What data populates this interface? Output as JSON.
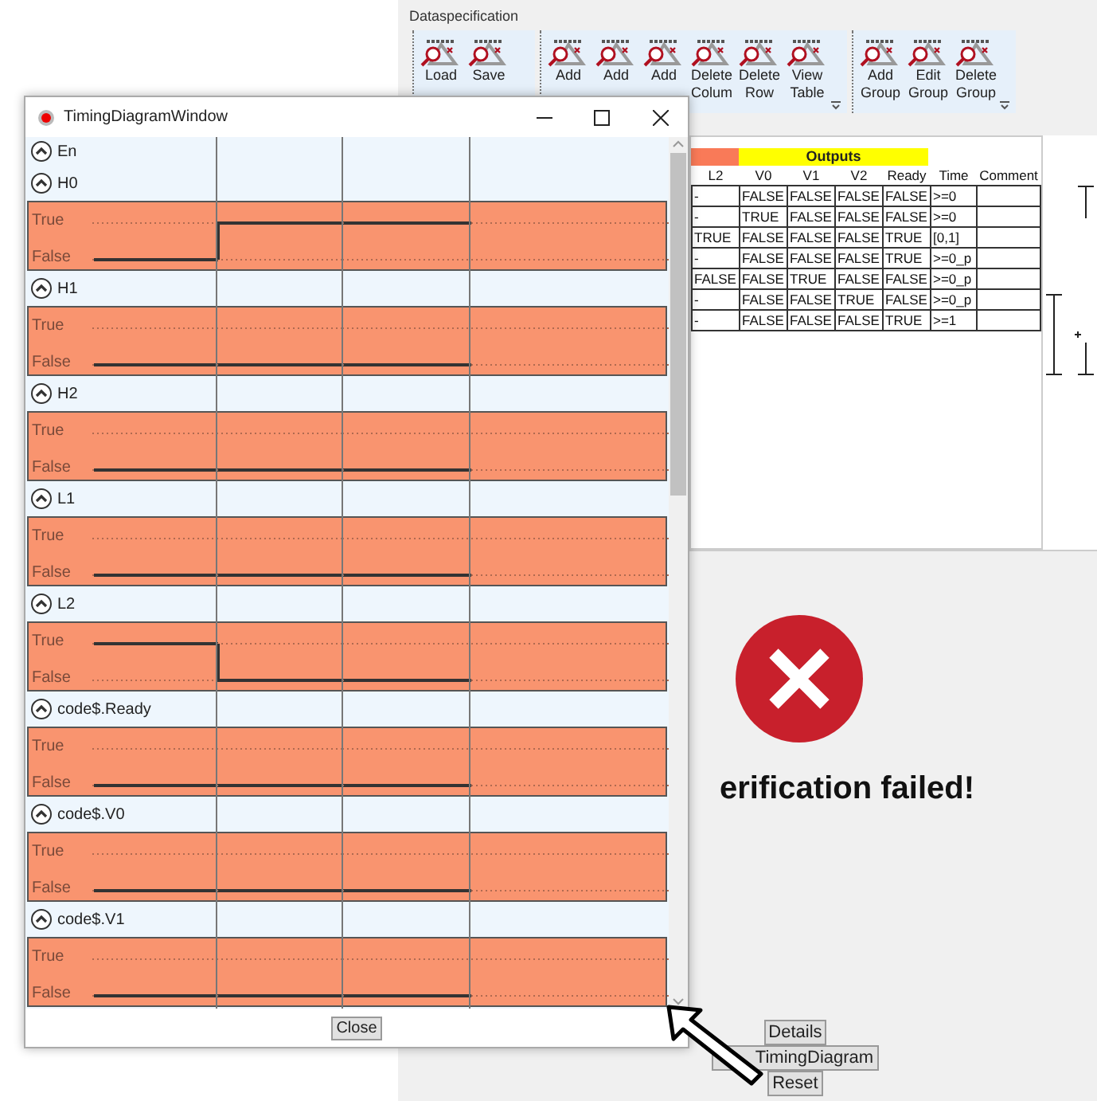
{
  "background_app": {
    "ribbon": {
      "title": "Dataspecification",
      "groups": [
        {
          "buttons": [
            {
              "lines": [
                "Load"
              ]
            },
            {
              "lines": [
                "Save"
              ]
            }
          ],
          "overflow": false
        },
        {
          "buttons": [
            {
              "lines": [
                "Add"
              ]
            },
            {
              "lines": [
                "Add"
              ]
            },
            {
              "lines": [
                "Add"
              ]
            },
            {
              "lines": [
                "Delete",
                "Colum"
              ]
            },
            {
              "lines": [
                "Delete",
                "Row"
              ]
            },
            {
              "lines": [
                "View",
                "Table"
              ]
            }
          ],
          "overflow": true
        },
        {
          "buttons": [
            {
              "lines": [
                "Add",
                "Group"
              ]
            },
            {
              "lines": [
                "Edit",
                "Group"
              ]
            },
            {
              "lines": [
                "Delete",
                "Group"
              ]
            }
          ],
          "overflow": true
        }
      ]
    },
    "table": {
      "group_header": "Outputs",
      "columns": [
        "L2",
        "V0",
        "V1",
        "V2",
        "Ready",
        "Time",
        "Comment"
      ],
      "rows": [
        [
          "-",
          "FALSE",
          "FALSE",
          "FALSE",
          "FALSE",
          ">=0"
        ],
        [
          "-",
          "TRUE",
          "FALSE",
          "FALSE",
          "FALSE",
          ">=0"
        ],
        [
          "TRUE",
          "FALSE",
          "FALSE",
          "FALSE",
          "TRUE",
          "[0,1]"
        ],
        [
          "-",
          "FALSE",
          "FALSE",
          "FALSE",
          "TRUE",
          ">=0_p"
        ],
        [
          "FALSE",
          "FALSE",
          "TRUE",
          "FALSE",
          "FALSE",
          ">=0_p"
        ],
        [
          "-",
          "FALSE",
          "FALSE",
          "TRUE",
          "FALSE",
          ">=0_p"
        ],
        [
          "-",
          "FALSE",
          "FALSE",
          "FALSE",
          "TRUE",
          ">=1"
        ]
      ]
    },
    "result": {
      "message": "erification failed!"
    },
    "buttons": [
      "Details",
      "TimingDiagram",
      "Reset"
    ]
  },
  "timing_window": {
    "title": "TimingDiagramWindow",
    "signals": [
      {
        "name": "En",
        "kind": "header"
      },
      {
        "name": "H0",
        "kind": "plot",
        "true_label": "True",
        "false_label": "False",
        "values": [
          false,
          true,
          true
        ]
      },
      {
        "name": "H1",
        "kind": "plot",
        "true_label": "True",
        "false_label": "False",
        "values": [
          false,
          false,
          false
        ]
      },
      {
        "name": "H2",
        "kind": "plot",
        "true_label": "True",
        "false_label": "False",
        "values": [
          false,
          false,
          false
        ]
      },
      {
        "name": "L1",
        "kind": "plot",
        "true_label": "True",
        "false_label": "False",
        "values": [
          false,
          false,
          false
        ]
      },
      {
        "name": "L2",
        "kind": "plot",
        "true_label": "True",
        "false_label": "False",
        "values": [
          true,
          false,
          false
        ]
      },
      {
        "name": "code$.Ready",
        "kind": "plot",
        "true_label": "True",
        "false_label": "False",
        "values": [
          false,
          false,
          false
        ]
      },
      {
        "name": "code$.V0",
        "kind": "plot",
        "true_label": "True",
        "false_label": "False",
        "values": [
          false,
          false,
          false
        ]
      },
      {
        "name": "code$.V1",
        "kind": "plot",
        "true_label": "True",
        "false_label": "False",
        "values": [
          false,
          false,
          false
        ]
      }
    ],
    "close_button": "Close"
  }
}
